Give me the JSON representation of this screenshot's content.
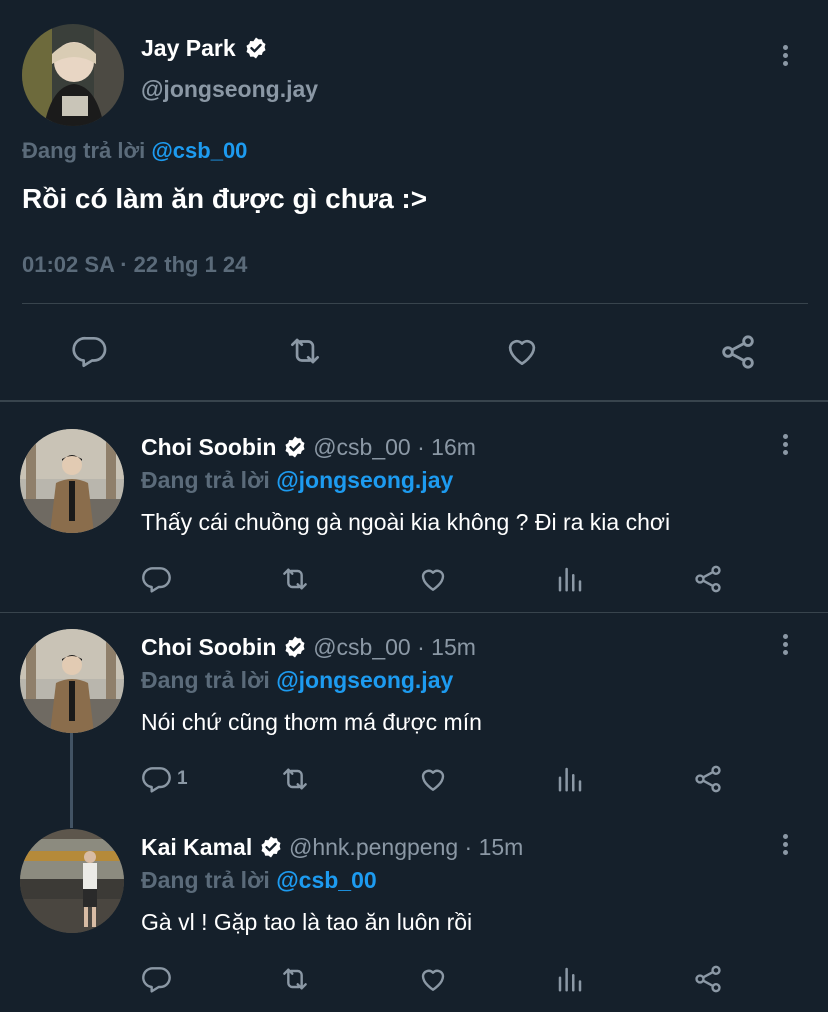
{
  "main_tweet": {
    "name": "Jay Park",
    "handle": "@jongseong.jay",
    "replying_prefix": "Đang trả lời",
    "replying_to": "@csb_00",
    "text": "Rồi có làm ăn được gì chưa :>",
    "timestamp": "01:02 SA · 22 thg 1 24"
  },
  "replies": [
    {
      "name": "Choi Soobin",
      "handle": "@csb_00 · 16m",
      "replying_prefix": "Đang trả lời",
      "replying_to": "@jongseong.jay",
      "text": "Thấy cái chuồng gà ngoài kia không ? Đi ra kia chơi",
      "reply_count": ""
    },
    {
      "name": "Choi Soobin",
      "handle": "@csb_00 · 15m",
      "replying_prefix": "Đang trả lời",
      "replying_to": "@jongseong.jay",
      "text": "Nói chứ cũng thơm má được mín",
      "reply_count": "1"
    },
    {
      "name": "Kai Kamal",
      "handle": "@hnk.pengpeng · 15m",
      "replying_prefix": "Đang trả lời",
      "replying_to": "@csb_00",
      "text": "Gà vl ! Gặp tao là tao ăn luôn rồi",
      "reply_count": ""
    }
  ],
  "colors": {
    "background": "#15202b",
    "accent": "#1d9bf0",
    "muted": "#8b98a5",
    "divider": "#38444d"
  },
  "icons": [
    "verified-badge-icon",
    "more-options-icon",
    "reply-icon",
    "retweet-icon",
    "like-icon",
    "views-icon",
    "share-icon"
  ]
}
